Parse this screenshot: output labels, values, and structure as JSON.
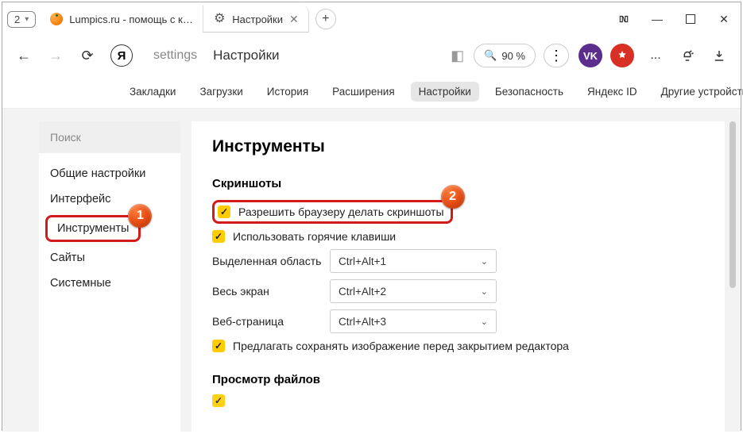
{
  "titlebar": {
    "counter": "2",
    "tab_inactive": {
      "label": "Lumpics.ru - помощь с ком"
    },
    "tab_active": {
      "label": "Настройки"
    },
    "new_tab_tooltip": "+"
  },
  "toolbar": {
    "logo_letter": "Я",
    "url_text": "settings",
    "page_title": "Настройки",
    "zoom_label": "90 %",
    "ext_purple_label": "VK",
    "more_dots": "..."
  },
  "topnav": {
    "items": [
      "Закладки",
      "Загрузки",
      "История",
      "Расширения",
      "Настройки",
      "Безопасность",
      "Яндекс ID",
      "Другие устройства"
    ],
    "active_index": 4
  },
  "sidebar": {
    "search_placeholder": "Поиск",
    "items": [
      "Общие настройки",
      "Интерфейс",
      "Инструменты",
      "Сайты",
      "Системные"
    ],
    "highlight_index": 2
  },
  "content": {
    "heading": "Инструменты",
    "screenshots_section": {
      "title": "Скриншоты",
      "check_allow": "Разрешить браузеру делать скриншоты",
      "check_hotkeys": "Использовать горячие клавиши",
      "rows": [
        {
          "label": "Выделенная область",
          "value": "Ctrl+Alt+1"
        },
        {
          "label": "Весь экран",
          "value": "Ctrl+Alt+2"
        },
        {
          "label": "Веб-страница",
          "value": "Ctrl+Alt+3"
        }
      ],
      "check_offer_save": "Предлагать сохранять изображение перед закрытием редактора"
    },
    "files_section": {
      "title": "Просмотр файлов"
    }
  },
  "annotations": {
    "ball1": "1",
    "ball2": "2"
  }
}
